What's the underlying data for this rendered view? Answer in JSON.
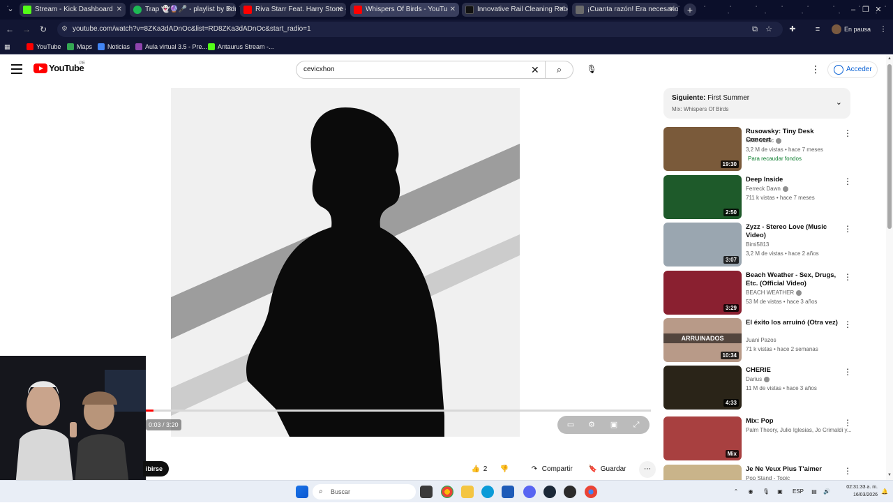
{
  "browser": {
    "tabs": [
      {
        "label": "Stream - Kick Dashboard",
        "color": "#53fc18"
      },
      {
        "label": "Trap 👻🔮🎤 - playlist by Edu",
        "color": "#1db954"
      },
      {
        "label": "Riva Starr Feat. Harry Stone - I",
        "color": "#ff0000"
      },
      {
        "label": "Whispers Of Birds - YouTu",
        "color": "#ff0000"
      },
      {
        "label": "Innovative Rail Cleaning Robot",
        "color": "#111111"
      },
      {
        "label": "¡Cuanta razón! Era necesario p",
        "color": "#6b6b6b"
      }
    ],
    "url": "youtube.com/watch?v=8ZKa3dADnOc&list=RD8ZKa3dADnOc&start_radio=1",
    "profile_label": "En pausa",
    "bookmarks": [
      {
        "label": "YouTube",
        "color": "#ff0000"
      },
      {
        "label": "Maps",
        "color": "#34a853"
      },
      {
        "label": "Noticias",
        "color": "#4285f4"
      },
      {
        "label": "Aula virtual 3.5 - Pre...",
        "color": "#8e44ad"
      },
      {
        "label": "Antaurus Stream -...",
        "color": "#53fc18"
      }
    ]
  },
  "youtube": {
    "logo_text": "YouTube",
    "country_code": "PE",
    "search_query": "cevicxhon",
    "signin_label": "Acceder",
    "player": {
      "time_display": "0:03 / 3:20",
      "progress_fraction": 0.015
    },
    "subscribe_label": "ibirse",
    "actions": {
      "like_count": "2",
      "share_label": "Compartir",
      "save_label": "Guardar"
    },
    "up_next": {
      "label": "Siguiente:",
      "title": "First Summer",
      "mix_label": "Mix: Whispers Of Birds"
    },
    "recommendations": [
      {
        "title": "Rusowsky: Tiny Desk Concert",
        "channel": "NPR Music",
        "verified": true,
        "meta": "3,2 M de vistas • hace 7 meses",
        "badge": "Para recaudar fondos",
        "duration": "19:30",
        "thumb": "#7a5a3a"
      },
      {
        "title": "Deep Inside",
        "channel": "Ferreck Dawn",
        "verified": true,
        "meta": "711 k vistas • hace 7 meses",
        "badge": "",
        "duration": "2:50",
        "thumb": "#1e5a2a"
      },
      {
        "title": "Zyzz - Stereo Love (Music Video)",
        "channel": "Bimi5813",
        "verified": false,
        "meta": "3,2 M de vistas • hace 2 años",
        "badge": "",
        "duration": "3:07",
        "thumb": "#9aa6b0"
      },
      {
        "title": "Beach Weather - Sex, Drugs, Etc. (Official Video)",
        "channel": "BEACH WEATHER",
        "verified": true,
        "meta": "53 M de vistas • hace 3 años",
        "badge": "",
        "duration": "3:29",
        "thumb": "#8a2030"
      },
      {
        "title": "El éxito los arruinó (Otra vez)",
        "channel": "Juani Pazos",
        "verified": false,
        "meta": "71 k vistas • hace 2 semanas",
        "badge": "",
        "duration": "10:34",
        "thumb": "#b89a88",
        "overlay": "ARRUINADOS"
      },
      {
        "title": "CHERIE",
        "channel": "Darius",
        "verified": true,
        "meta": "11 M de vistas • hace 3 años",
        "badge": "",
        "duration": "4:33",
        "thumb": "#2a2418"
      },
      {
        "title": "Mix: Pop",
        "channel": "Palm Theory, Julio Iglesias, Jo Crimaldi y...",
        "verified": false,
        "meta": "",
        "badge": "",
        "duration": "Mix",
        "thumb": "#a84040"
      },
      {
        "title": "Je Ne Veux Plus T'aimer",
        "channel": "Pop Stand - Topic",
        "verified": false,
        "meta": "",
        "badge": "",
        "duration": "",
        "thumb": "#c9b48a"
      }
    ]
  },
  "taskbar": {
    "search_placeholder": "Buscar",
    "lang": "ESP",
    "time": "02:31:33 a. m.",
    "date": "16/03/2026"
  },
  "colors": {
    "accent": "#ff0000",
    "link": "#065fd4"
  }
}
